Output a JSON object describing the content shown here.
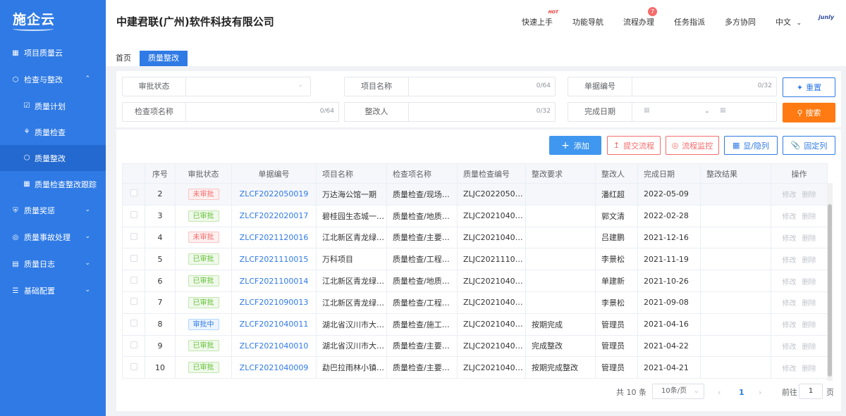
{
  "app": {
    "logo": "施企云",
    "company": "中建君联(广州)软件科技有限公司",
    "brand": "junly"
  },
  "header": {
    "nav": [
      {
        "label": "快速上手",
        "badge": "HOT"
      },
      {
        "label": "功能导航"
      },
      {
        "label": "流程办理",
        "count": "7"
      },
      {
        "label": "任务指派"
      },
      {
        "label": "多方协同"
      },
      {
        "label": "中文"
      }
    ]
  },
  "sidebar": {
    "items": [
      {
        "label": "项目质量云",
        "icon": "grid-icon"
      },
      {
        "label": "检查与整改",
        "icon": "cube-icon",
        "expanded": true
      },
      {
        "label": "质量计划",
        "icon": "calendar-check-icon",
        "sub": true
      },
      {
        "label": "质量检查",
        "icon": "org-chart-icon",
        "sub": true
      },
      {
        "label": "质量整改",
        "icon": "cube-icon",
        "sub": true,
        "active": true
      },
      {
        "label": "质量检查整改跟踪",
        "icon": "calendar-icon",
        "sub": true
      },
      {
        "label": "质量奖惩",
        "icon": "shield-icon"
      },
      {
        "label": "质量事故处理",
        "icon": "target-icon"
      },
      {
        "label": "质量日志",
        "icon": "log-icon"
      },
      {
        "label": "基础配置",
        "icon": "layers-icon"
      }
    ]
  },
  "tabs": [
    {
      "label": "首页"
    },
    {
      "label": "质量整改",
      "active": true
    }
  ],
  "search": {
    "fields": [
      {
        "label": "审批状态",
        "count": ""
      },
      {
        "label": "项目名称",
        "count": "0/64"
      },
      {
        "label": "单据编号",
        "count": "0/32"
      },
      {
        "label": "检查项名称",
        "count": "0/64"
      },
      {
        "label": "整改人",
        "count": "0/32"
      },
      {
        "label": "完成日期",
        "count": ""
      }
    ],
    "date_sep": "-",
    "reset_label": "重置",
    "search_label": "搜索"
  },
  "toolbar": {
    "add": "添加",
    "submit_flow": "提交流程",
    "monitor_flow": "流程监控",
    "show_hide": "显/隐列",
    "fixed_col": "固定列"
  },
  "table": {
    "columns": [
      "序号",
      "审批状态",
      "单据编号",
      "项目名称",
      "检查项名称",
      "质量检查编号",
      "整改要求",
      "整改人",
      "完成日期",
      "整改结果",
      "操作"
    ],
    "edit_label": "修改",
    "delete_label": "删除",
    "rows": [
      {
        "no": "2",
        "status": "未审批",
        "status_type": "no",
        "code": "ZLCF2022050019",
        "project": "万达海公馆一期",
        "item": "质量检查/现场…",
        "check_no": "ZLJC20220500…",
        "req": "",
        "person": "潘红超",
        "date": "2022-05-09",
        "result": ""
      },
      {
        "no": "3",
        "status": "已审批",
        "status_type": "ok",
        "code": "ZLCF2022020017",
        "project": "碧桂园生态城一…",
        "item": "质量检查/地质…",
        "check_no": "ZLJC20210400…",
        "req": "",
        "person": "郭文清",
        "date": "2022-02-28",
        "result": ""
      },
      {
        "no": "4",
        "status": "未审批",
        "status_type": "no",
        "code": "ZLCF2021120016",
        "project": "江北新区青龙绿…",
        "item": "质量检查/主要…",
        "check_no": "ZLJC20210400…",
        "req": "",
        "person": "吕建鹏",
        "date": "2021-12-16",
        "result": ""
      },
      {
        "no": "5",
        "status": "已审批",
        "status_type": "ok",
        "code": "ZLCF2021110015",
        "project": "万科项目",
        "item": "质量检查/工程…",
        "check_no": "ZLJC20211100…",
        "req": "",
        "person": "李景松",
        "date": "2021-11-19",
        "result": ""
      },
      {
        "no": "6",
        "status": "已审批",
        "status_type": "ok",
        "code": "ZLCF2021100014",
        "project": "江北新区青龙绿…",
        "item": "质量检查/地质…",
        "check_no": "ZLJC20210400…",
        "req": "",
        "person": "单建新",
        "date": "2021-10-26",
        "result": ""
      },
      {
        "no": "7",
        "status": "已审批",
        "status_type": "ok",
        "code": "ZLCF2021090013",
        "project": "江北新区青龙绿…",
        "item": "质量检查/工程…",
        "check_no": "ZLJC20210400…",
        "req": "",
        "person": "李景松",
        "date": "2021-09-08",
        "result": ""
      },
      {
        "no": "8",
        "status": "审批中",
        "status_type": "ing",
        "code": "ZLCF2021040011",
        "project": "湖北省汉川市大…",
        "item": "质量检查/施工…",
        "check_no": "ZLJC20210400…",
        "req": "按期完成",
        "person": "管理员",
        "date": "2021-04-16",
        "result": ""
      },
      {
        "no": "9",
        "status": "已审批",
        "status_type": "ok",
        "code": "ZLCF2021040010",
        "project": "湖北省汉川市大…",
        "item": "质量检查/主要…",
        "check_no": "ZLJC20210400…",
        "req": "完成整改",
        "person": "管理员",
        "date": "2021-04-22",
        "result": ""
      },
      {
        "no": "10",
        "status": "已审批",
        "status_type": "ok",
        "code": "ZLCF2021040009",
        "project": "勐巴拉雨林小镇…",
        "item": "质量检查/主要…",
        "check_no": "ZLJC20210400…",
        "req": "按期完成整改",
        "person": "管理员",
        "date": "2021-04-21",
        "result": ""
      }
    ]
  },
  "pagination": {
    "total": "共 10 条",
    "page_size": "10条/页",
    "current": "1",
    "goto_label": "前往",
    "goto_value": "1",
    "page_unit": "页"
  }
}
